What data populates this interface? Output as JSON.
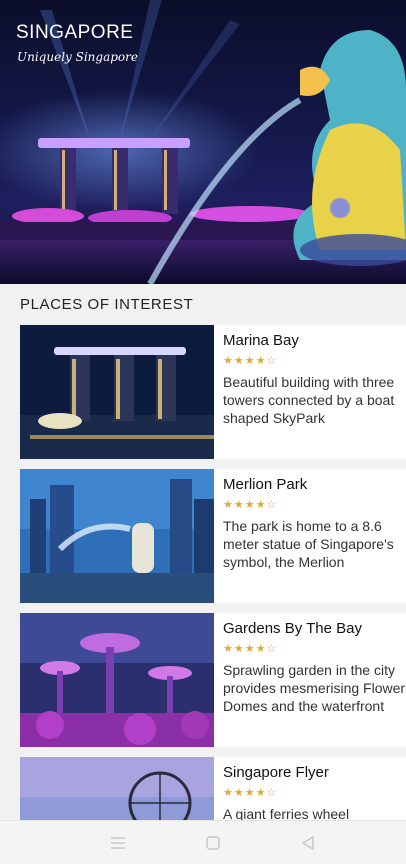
{
  "hero": {
    "title": "SINGAPORE",
    "subtitle": "Uniquely Singapore"
  },
  "section": {
    "title": "PLACES OF INTEREST"
  },
  "places": [
    {
      "title": "Marina Bay",
      "stars": "★★★★☆",
      "rating": 4,
      "description": "Beautiful building with three towers connected by a boat shaped SkyPark"
    },
    {
      "title": "Merlion Park",
      "stars": "★★★★☆",
      "rating": 4,
      "description": "The park is home to a 8.6 meter statue of Singapore's symbol, the Merlion"
    },
    {
      "title": "Gardens By The Bay",
      "stars": "★★★★☆",
      "rating": 4,
      "description": "Sprawling garden in the city provides mesmerising Flower Domes and the waterfront"
    },
    {
      "title": "Singapore Flyer",
      "stars": "★★★★☆",
      "rating": 4,
      "description": "A giant ferries wheel"
    }
  ],
  "colors": {
    "star": "#e0a93a",
    "background": "#f1f1f1"
  },
  "navbar": {
    "menu_icon": "menu-icon",
    "home_icon": "home-square-icon",
    "back_icon": "back-triangle-icon"
  }
}
